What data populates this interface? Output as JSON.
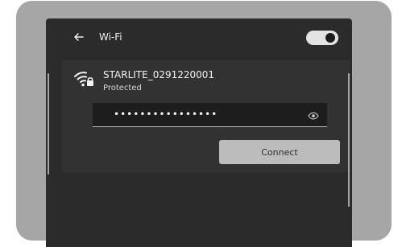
{
  "header": {
    "title": "Wi-Fi",
    "back_icon": "back-arrow-icon",
    "toggle_state": "on"
  },
  "network": {
    "ssid": "STARLITE_0291220001",
    "status": "Protected",
    "icon": "wifi-lock-icon"
  },
  "password": {
    "value": "••••••••••••••••",
    "reveal_icon": "eye-icon"
  },
  "actions": {
    "connect_label": "Connect"
  },
  "colors": {
    "frame": "#a6a6a6",
    "screen": "#2b2b2b",
    "panel": "#323232",
    "field": "#1d1d1d",
    "button": "#bcbcbc"
  }
}
